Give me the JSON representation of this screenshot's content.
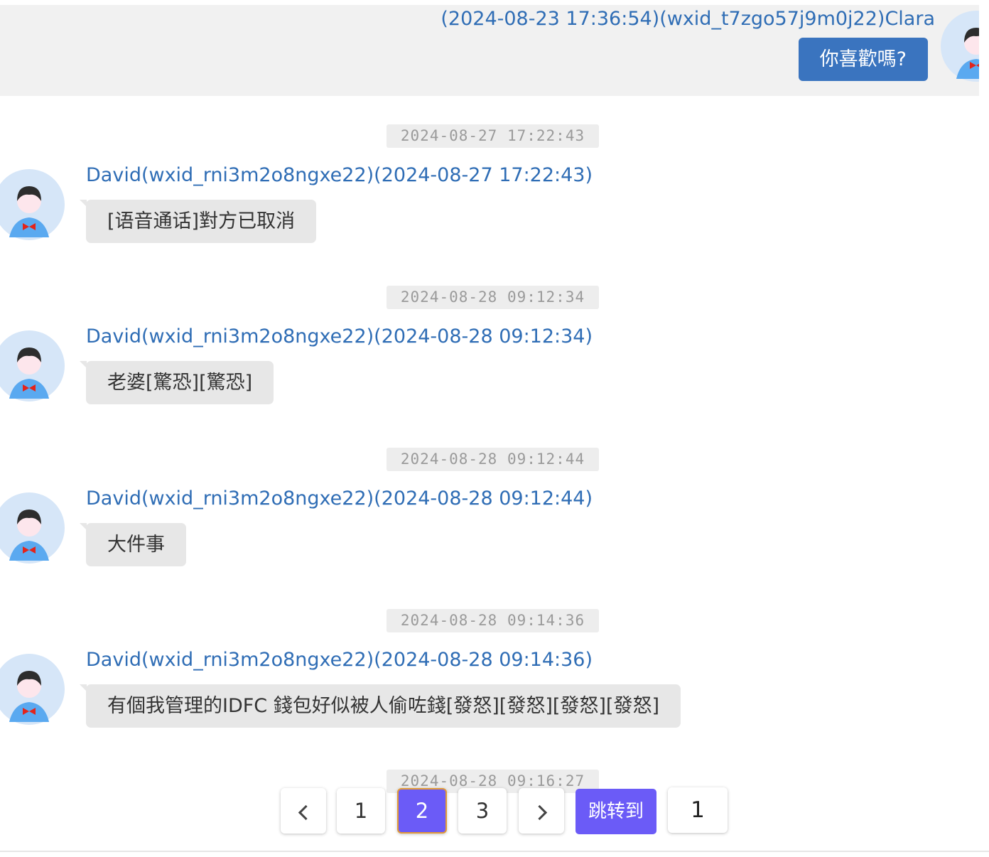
{
  "self_message": {
    "meta": "(2024-08-23 17:36:54)(wxid_t7zgo57j9m0j22)Clara",
    "text": "你喜歡嗎?"
  },
  "messages": [
    {
      "timestamp": "2024-08-27 17:22:43",
      "sender": "David(wxid_rni3m2o8ngxe22)(2024-08-27 17:22:43)",
      "text": "[语音通话]對方已取消"
    },
    {
      "timestamp": "2024-08-28 09:12:34",
      "sender": "David(wxid_rni3m2o8ngxe22)(2024-08-28 09:12:34)",
      "text": "老婆[驚恐][驚恐]"
    },
    {
      "timestamp": "2024-08-28 09:12:44",
      "sender": "David(wxid_rni3m2o8ngxe22)(2024-08-28 09:12:44)",
      "text": "大件事"
    },
    {
      "timestamp": "2024-08-28 09:14:36",
      "sender": "David(wxid_rni3m2o8ngxe22)(2024-08-28 09:14:36)",
      "text": "有個我管理的IDFC 錢包好似被人偷咗錢[發怒][發怒][發怒][發怒]"
    },
    {
      "timestamp": "2024-08-28 09:16:27"
    }
  ],
  "pagination": {
    "pages": [
      "1",
      "2",
      "3"
    ],
    "current": "2",
    "jump_label": "跳转到",
    "jump_value": "1"
  },
  "colors": {
    "accent": "#6b5bf7",
    "sender_link": "#2f6db5",
    "self_bubble": "#3a74bf"
  },
  "icons": {
    "avatar": "user-avatar-icon",
    "prev": "chevron-left-icon",
    "next": "chevron-right-icon"
  }
}
